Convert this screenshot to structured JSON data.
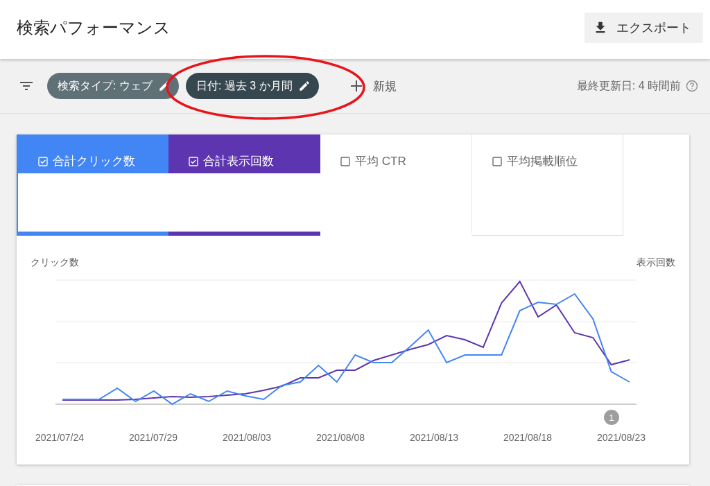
{
  "header": {
    "title": "検索パフォーマンス",
    "export_button": "エクスポート"
  },
  "filter_bar": {
    "chips": [
      {
        "label": "検索タイプ: ウェブ",
        "highlighted": false
      },
      {
        "label": "日付: 過去 3 か月間",
        "highlighted": true
      }
    ],
    "new_button": "新規",
    "last_updated": "最終更新日: 4 時間前"
  },
  "metrics": [
    {
      "label": "合計クリック数",
      "checked": true,
      "color": "#4285f4"
    },
    {
      "label": "合計表示回数",
      "checked": true,
      "color": "#5e35b1"
    },
    {
      "label": "平均 CTR",
      "checked": false
    },
    {
      "label": "平均掲載順位",
      "checked": false
    }
  ],
  "chart": {
    "left_axis_label": "クリック数",
    "right_axis_label": "表示回数",
    "x_labels": [
      "2021/07/24",
      "2021/07/29",
      "2021/08/03",
      "2021/08/08",
      "2021/08/13",
      "2021/08/18",
      "2021/08/23"
    ],
    "annotation": "1"
  }
}
